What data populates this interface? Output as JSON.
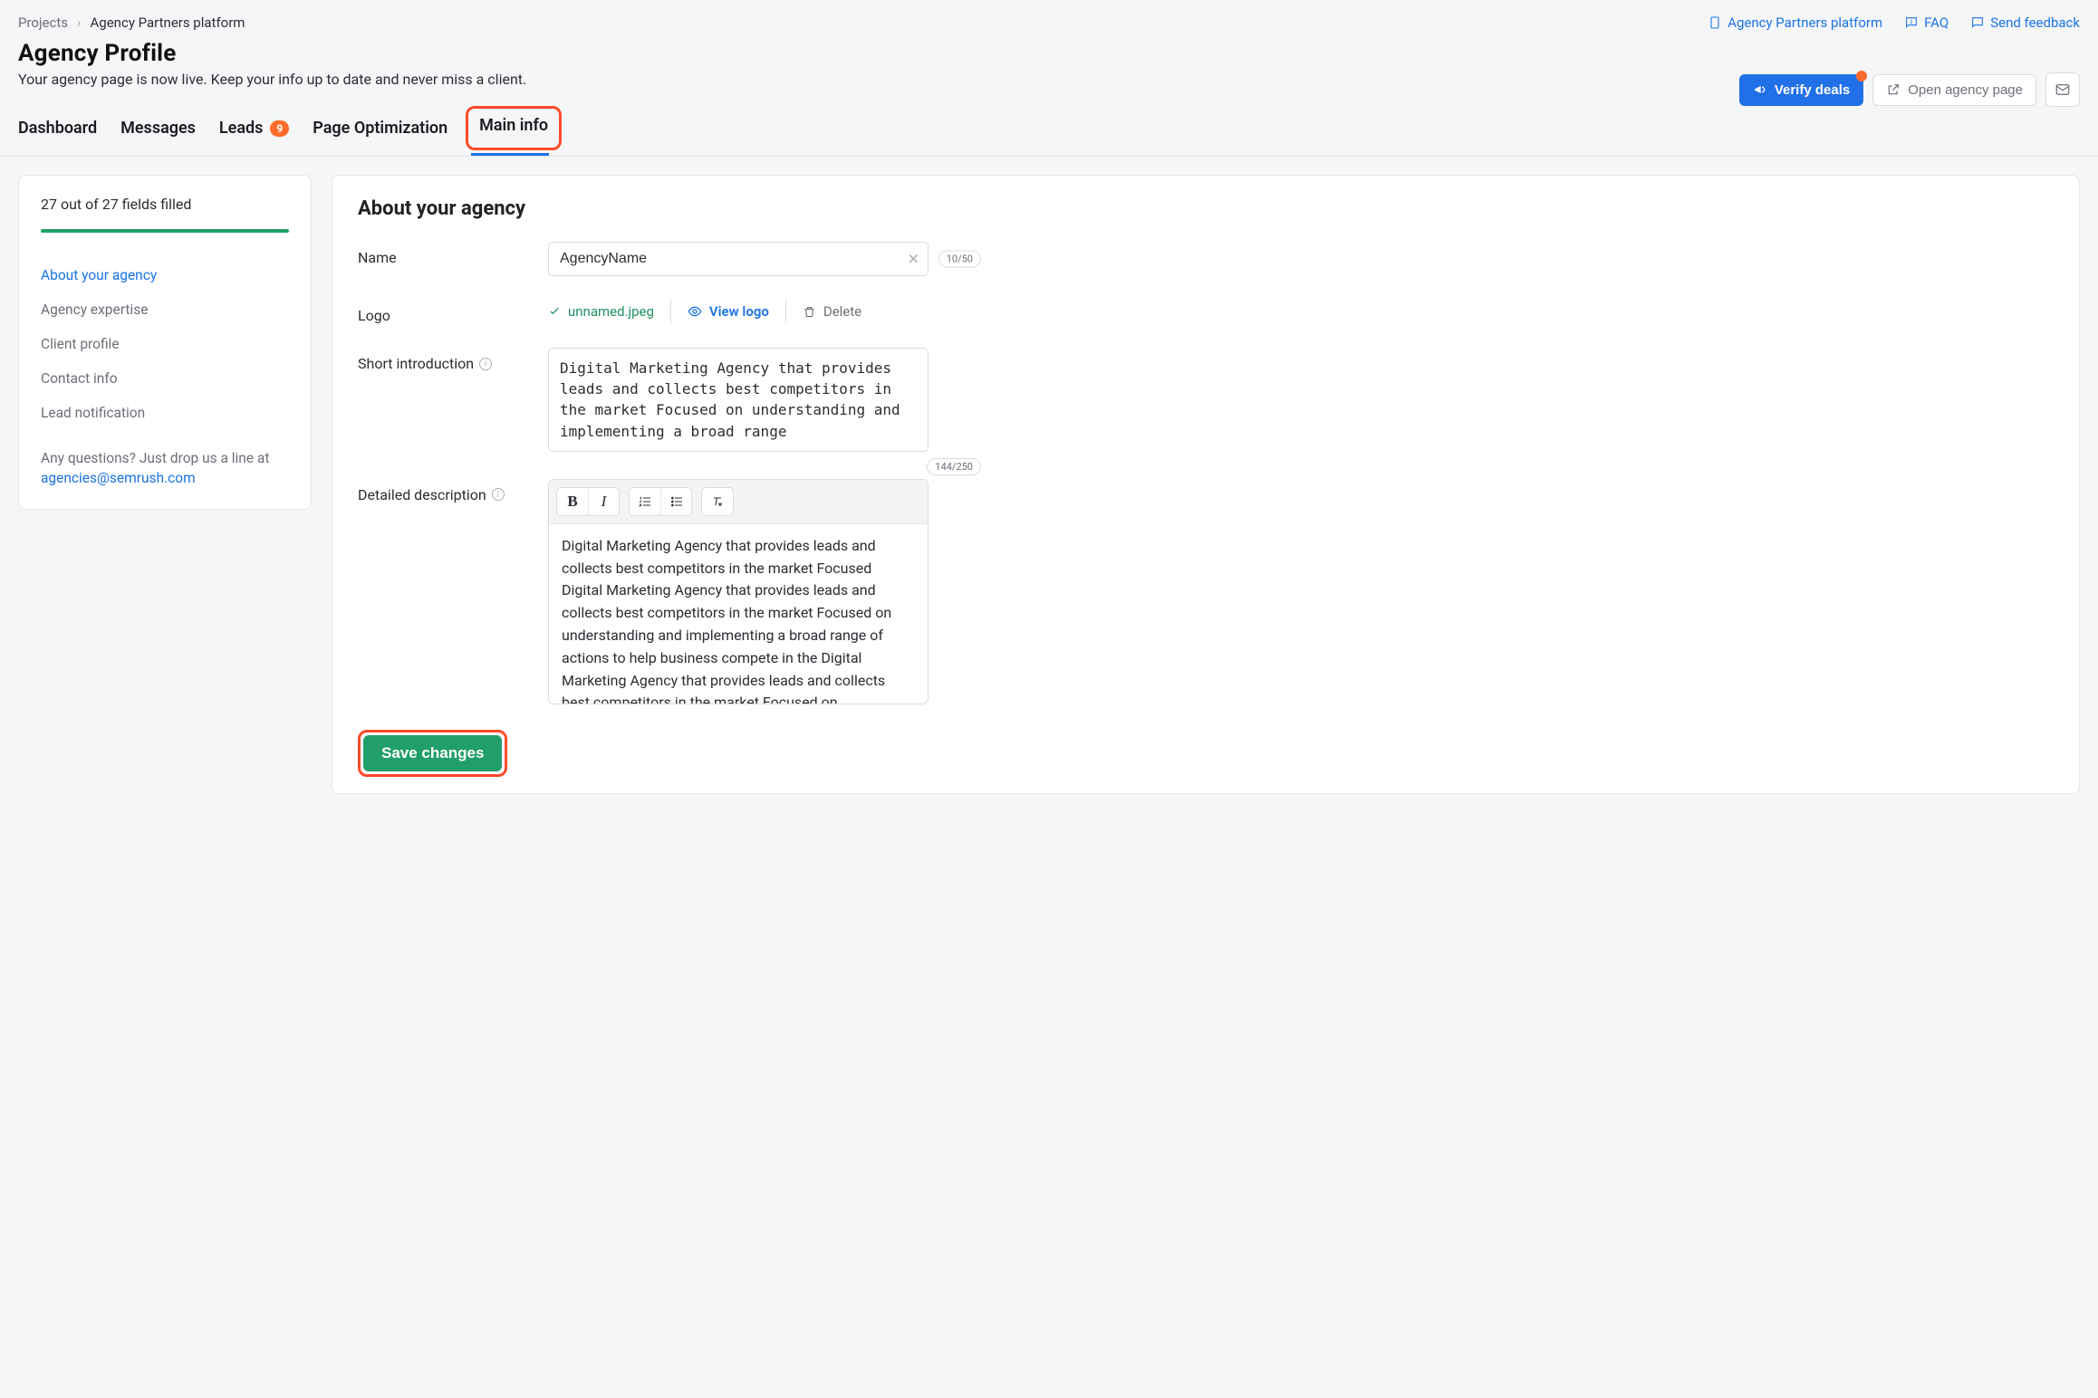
{
  "breadcrumb": {
    "root": "Projects",
    "current": "Agency Partners platform"
  },
  "toplinks": {
    "platform": "Agency Partners platform",
    "faq": "FAQ",
    "feedback": "Send feedback"
  },
  "page": {
    "title": "Agency Profile",
    "subtitle": "Your agency page is now live. Keep your info up to date and never miss a client."
  },
  "actions": {
    "verify": "Verify deals",
    "open": "Open agency page"
  },
  "tabs": {
    "dashboard": "Dashboard",
    "messages": "Messages",
    "leads": "Leads",
    "leads_count": "9",
    "page_opt": "Page Optimization",
    "main_info": "Main info"
  },
  "sidebar": {
    "progress_label": "27 out of 27 fields filled",
    "items": {
      "about": "About your agency",
      "expertise": "Agency expertise",
      "client": "Client profile",
      "contact": "Contact info",
      "lead": "Lead notification"
    },
    "help_prefix": "Any questions? Just drop us a line at ",
    "help_email": "agencies@semrush.com"
  },
  "form": {
    "heading": "About your agency",
    "name_label": "Name",
    "name_value": "AgencyName",
    "name_counter": "10/50",
    "logo_label": "Logo",
    "logo_filename": "unnamed.jpeg",
    "logo_view": "View logo",
    "logo_delete": "Delete",
    "short_label": "Short introduction",
    "short_value": "Digital Marketing Agency that provides leads and collects best competitors in the market Focused on understanding and implementing a broad range",
    "short_counter": "144/250",
    "detailed_label": "Detailed description",
    "detailed_value": "Digital Marketing Agency that provides leads and collects best competitors in the market Focused Digital Marketing Agency that provides leads and collects best competitors in the market Focused on understanding and implementing a broad range of actions to help business compete in the Digital Marketing Agency that provides leads and collects best competitors in the market Focused on understanding and implementing a broad range of"
  },
  "save_label": "Save changes"
}
